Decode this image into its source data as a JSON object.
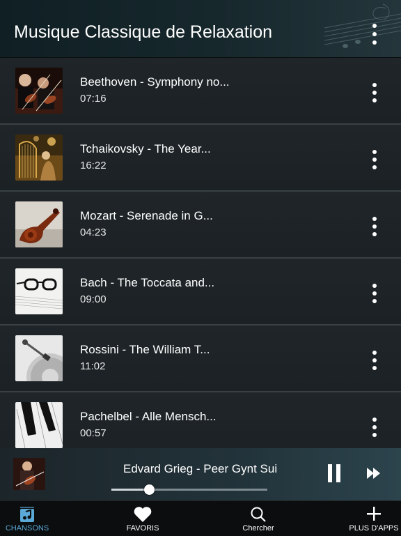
{
  "header": {
    "title": "Musique Classique de Relaxation"
  },
  "songs": [
    {
      "title": "Beethoven - Symphony no...",
      "duration": "07:16",
      "art": "violin-orchestra"
    },
    {
      "title": "Tchaikovsky - The Year...",
      "duration": "16:22",
      "art": "harp-player"
    },
    {
      "title": "Mozart - Serenade in G...",
      "duration": "04:23",
      "art": "violin-scroll"
    },
    {
      "title": "Bach - The Toccata and...",
      "duration": "09:00",
      "art": "glasses-on-sheet-music"
    },
    {
      "title": "Rossini - The William T...",
      "duration": "11:02",
      "art": "turntable-tonearm"
    },
    {
      "title": "Pachelbel - Alle Mensch...",
      "duration": "00:57",
      "art": "piano-keys"
    }
  ],
  "player": {
    "title": "Edvard Grieg - Peer Gynt Sui",
    "progress": 0.24
  },
  "tabs": [
    {
      "label": "CHANSONS",
      "icon": "music-note-icon",
      "active": true
    },
    {
      "label": "FAVORIS",
      "icon": "heart-icon",
      "active": false
    },
    {
      "label": "Chercher",
      "icon": "search-icon",
      "active": false
    },
    {
      "label": "PLUS D'APPS",
      "icon": "plus-icon",
      "active": false
    }
  ],
  "colors": {
    "accent": "#5aa9d6",
    "background": "#1c2226",
    "tabbar": "#0b0d0e"
  }
}
